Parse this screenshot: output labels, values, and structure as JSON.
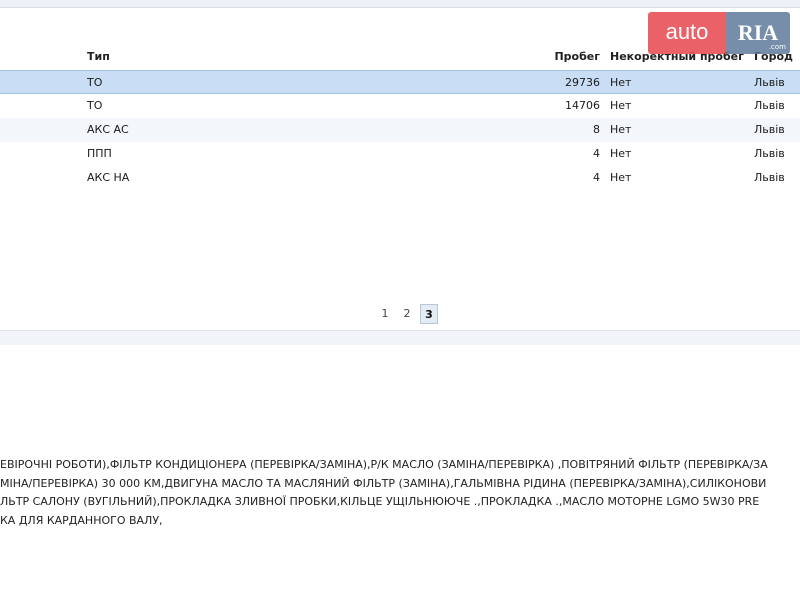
{
  "logo": {
    "left": "auto",
    "right": "RIA",
    "suffix": ".com"
  },
  "table": {
    "headers": {
      "type": "Тип",
      "mileage": "Пробег",
      "incorrect": "Некоректный пробег",
      "city": "Город"
    },
    "rows": [
      {
        "type": "ТО",
        "mileage": "29736",
        "incorrect": "Нет",
        "city": "Львів"
      },
      {
        "type": "ТО",
        "mileage": "14706",
        "incorrect": "Нет",
        "city": "Львів"
      },
      {
        "type": "АКС АС",
        "mileage": "8",
        "incorrect": "Нет",
        "city": "Львів"
      },
      {
        "type": "ППП",
        "mileage": "4",
        "incorrect": "Нет",
        "city": "Львів"
      },
      {
        "type": "АКС НА",
        "mileage": "4",
        "incorrect": "Нет",
        "city": "Львів"
      }
    ]
  },
  "pager": {
    "pages": [
      "1",
      "2",
      "3"
    ],
    "current": "3"
  },
  "description": {
    "lines": [
      "ЕВІРОЧНІ РОБОТИ),ФІЛЬТР КОНДИЦІОНЕРА (ПЕРЕВІРКА/ЗАМІНА),Р/К МАСЛО (ЗАМІНА/ПЕРЕВІРКА) ,ПОВІТРЯНИЙ ФІЛЬТР (ПЕРЕВІРКА/ЗА",
      "МІНА/ПЕРЕВІРКА) 30 000 КМ,ДВИГУНА МАСЛО ТА МАСЛЯНИЙ ФІЛЬТР (ЗАМІНА),ГАЛЬМІВНА РІДИНА (ПЕРЕВІРКА/ЗАМІНА),СИЛІКОНОВИ",
      "ЛЬТР САЛОНУ (ВУГІЛЬНИЙ),ПРОКЛАДКА ЗЛИВНОЇ ПРОБКИ,КІЛЬЦЕ УЩІЛЬНЮЮЧЕ .,ПРОКЛАДКА .,МАСЛО МОТОРНЕ LGMO 5W30 PRE",
      "КА ДЛЯ КАРДАННОГО ВАЛУ,"
    ]
  }
}
